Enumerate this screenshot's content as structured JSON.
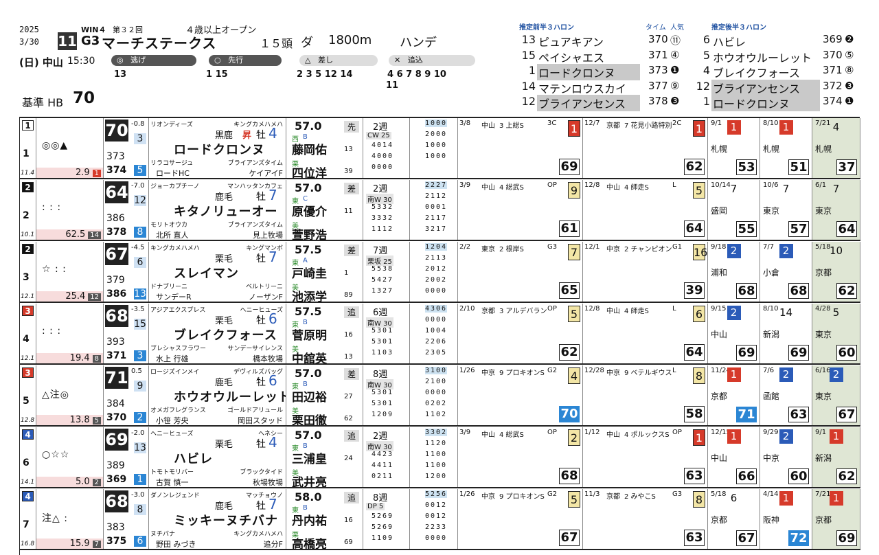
{
  "race": {
    "year": "2025",
    "date": "3/30",
    "day_venue": "(日) 中山",
    "time": "15:30",
    "race_no": "11",
    "win_label": "WIN４",
    "edition": "第３２回",
    "grade": "G3",
    "name": "マーチステークス",
    "condition": "４歳以上オープン",
    "field": "１５頭",
    "surface": "ダ",
    "distance": "1800m",
    "weight_rule": "ハンデ",
    "std_label": "基準 HB",
    "std_value": "70"
  },
  "pace": {
    "nige_label": "逃げ",
    "nige": "13",
    "senko_label": "先行",
    "senko": "1 15",
    "sashi_label": "差し",
    "sashi": "2 3 5 12 14",
    "oikomi_label": "追込",
    "oikomi": "4 6 7 8 9 10",
    "oikomi2": "11"
  },
  "front3f": {
    "title": "推定前半３ハロン",
    "col_time": "タイム",
    "col_pop": "人気",
    "rows": [
      {
        "no": "13",
        "name": "ピュアキアン",
        "time": "370",
        "pop": "⑪"
      },
      {
        "no": "15",
        "name": "ペイシャエス",
        "time": "371",
        "pop": "④"
      },
      {
        "no": "1",
        "name": "ロードクロンヌ",
        "time": "373",
        "pop": "❶"
      },
      {
        "no": "14",
        "name": "マテンロウスカイ",
        "time": "377",
        "pop": "⑨"
      },
      {
        "no": "12",
        "name": "ブライアンセンス",
        "time": "378",
        "pop": "❸"
      }
    ]
  },
  "back3f": {
    "title": "推定後半３ハロン",
    "rows": [
      {
        "no": "6",
        "name": "ハビレ",
        "time": "369",
        "pop": "❷"
      },
      {
        "no": "5",
        "name": "ホウオウルーレット",
        "time": "370",
        "pop": "⑤"
      },
      {
        "no": "4",
        "name": "ブレイクフォース",
        "time": "371",
        "pop": "⑧"
      },
      {
        "no": "12",
        "name": "ブライアンセンス",
        "time": "372",
        "pop": "❸"
      },
      {
        "no": "1",
        "name": "ロードクロンヌ",
        "time": "374",
        "pop": "❶"
      }
    ]
  },
  "horses": [
    {
      "gate": "1",
      "gate_bg": "#ffffff",
      "gate_fg": "#111",
      "no": "1",
      "marks": "◎◎▲",
      "weight": "11.4",
      "odds": "2.9",
      "pop": "1",
      "idx": "70",
      "idx_diff": "-0.8",
      "i1": "373",
      "i2": "374",
      "ia": "3",
      "ib": "5",
      "sire": "リオンディーズ",
      "dam_sire_top": "キングカメハメハ",
      "color": "黒鹿",
      "tag": "昇",
      "sex": "牡",
      "age": "4",
      "name": "ロードクロンヌ",
      "dam": "リラコサージュ",
      "damsire": "ブライアンズタイム",
      "owner": "ロードHC",
      "breeder": "ケイアイF",
      "kg": "57.0",
      "style": "先",
      "st1": "西",
      "st2": "B",
      "j1": "藤岡佑",
      "j1n": "13",
      "trainer_mark": "栗",
      "j2": "四位洋",
      "j2n": "39",
      "wk": "2週",
      "train": "CW 25",
      "tr": [
        "4014",
        "4000",
        "0000"
      ],
      "dist": [
        "1000",
        "2000",
        "1000",
        "1000"
      ],
      "p1": {
        "date": "3/8",
        "venue": "中山",
        "cls": "3 上総S",
        "grade": "3C",
        "rank": "1",
        "fig": "69"
      },
      "p2": {
        "date": "12/7",
        "venue": "京都",
        "cls": "7 花見小路特別",
        "grade": "2C",
        "rank": "1",
        "fig": "62"
      },
      "s1": {
        "date": "9/1",
        "rank": "1",
        "place": "札幌",
        "fig": "53"
      },
      "s2": {
        "date": "8/10",
        "rank": "1",
        "place": "札幌",
        "fig": "51"
      },
      "s3": {
        "date": "7/21",
        "rank": "4",
        "place": "札幌",
        "fig": "37"
      }
    },
    {
      "gate": "2",
      "gate_bg": "#111111",
      "gate_fg": "#fff",
      "no": "2",
      "marks": ": : :",
      "weight": "10.1",
      "odds": "62.5",
      "pop": "14",
      "idx": "64",
      "idx_diff": "-7.0",
      "i1": "386",
      "i2": "378",
      "ia": "12",
      "ib": "8",
      "sire": "ジョーカプチーノ",
      "dam_sire_top": "マンハッタンカフェ",
      "color": "鹿毛",
      "tag": "",
      "sex": "牡",
      "age": "7",
      "name": "キタノリューオー",
      "dam": "モリトオウカ",
      "damsire": "ブライアンズタイム",
      "owner": "北所 直人",
      "breeder": "見上牧場",
      "kg": "57.0",
      "style": "差",
      "st1": "東",
      "st2": "C",
      "j1": "原優介",
      "j1n": "11",
      "trainer_mark": "美",
      "j2": "萱野浩",
      "j2n": "",
      "wk": "2週",
      "train": "南W 30",
      "tr": [
        "5332",
        "3332",
        "1112"
      ],
      "dist": [
        "2227",
        "2112",
        "0001",
        "2117",
        "3217"
      ],
      "p1": {
        "date": "3/9",
        "venue": "中山",
        "cls": "4 総武S",
        "grade": "OP",
        "rank": "9",
        "fig": "61"
      },
      "p2": {
        "date": "12/8",
        "venue": "中山",
        "cls": "4 師走S",
        "grade": "L",
        "rank": "5",
        "fig": "64"
      },
      "s1": {
        "date": "10/14",
        "rank": "7",
        "place": "盛岡",
        "fig": "55"
      },
      "s2": {
        "date": "10/6",
        "rank": "7",
        "place": "東京",
        "fig": "57"
      },
      "s3": {
        "date": "6/1",
        "rank": "7",
        "place": "東京",
        "fig": "64"
      }
    },
    {
      "gate": "2",
      "gate_bg": "#111111",
      "gate_fg": "#fff",
      "no": "3",
      "marks": "☆ : :",
      "weight": "12.1",
      "odds": "25.4",
      "pop": "12",
      "idx": "67",
      "idx_diff": "-4.5",
      "i1": "379",
      "i2": "386",
      "ia": "6",
      "ib": "13",
      "sire": "キングカメハメハ",
      "dam_sire_top": "キングマンボ",
      "color": "栗毛",
      "tag": "",
      "sex": "牡",
      "age": "7",
      "name": "スレイマン",
      "dam": "ドナブリーニ",
      "damsire": "ベルトリーニ",
      "owner": "サンデーR",
      "breeder": "ノーザンF",
      "kg": "57.5",
      "style": "差",
      "st1": "東",
      "st2": "A",
      "j1": "戸崎圭",
      "j1n": "1",
      "trainer_mark": "美",
      "j2": "池添学",
      "j2n": "89",
      "wk": "7週",
      "train": "栗坂 25",
      "tr": [
        "5538",
        "5427",
        "1327"
      ],
      "dist": [
        "1204",
        "2113",
        "2012",
        "2002",
        "0000"
      ],
      "p1": {
        "date": "2/2",
        "venue": "東京",
        "cls": "2 根岸S",
        "grade": "G3",
        "rank": "7",
        "fig": "65"
      },
      "p2": {
        "date": "12/1",
        "venue": "中京",
        "cls": "2 チャンピオン",
        "grade": "G1",
        "rank": "16",
        "fig": "39"
      },
      "s1": {
        "date": "9/18",
        "rank": "2",
        "place": "浦和",
        "fig": "68"
      },
      "s2": {
        "date": "7/7",
        "rank": "2",
        "place": "小倉",
        "fig": "68"
      },
      "s3": {
        "date": "5/18",
        "rank": "10",
        "place": "京都",
        "fig": "62"
      }
    },
    {
      "gate": "3",
      "gate_bg": "#d63a2a",
      "gate_fg": "#fff",
      "no": "4",
      "marks": ": : :",
      "weight": "12.1",
      "odds": "19.4",
      "pop": "8",
      "idx": "68",
      "idx_diff": "-3.5",
      "i1": "393",
      "i2": "371",
      "ia": "15",
      "ib": "3",
      "sire": "アジアエクスプレス",
      "dam_sire_top": "ヘニーヒューズ",
      "color": "栗毛",
      "tag": "",
      "sex": "牡",
      "age": "6",
      "name": "ブレイクフォース",
      "dam": "ブレシャスフラワー",
      "damsire": "サンデーサイレンス",
      "owner": "水上 行雄",
      "breeder": "橋本牧場",
      "kg": "57.5",
      "style": "追",
      "st1": "東",
      "st2": "B",
      "j1": "菅原明",
      "j1n": "16",
      "trainer_mark": "美",
      "j2": "中舘英",
      "j2n": "13",
      "wk": "6週",
      "train": "南W 30",
      "tr": [
        "5301",
        "5301",
        "1103"
      ],
      "dist": [
        "4306",
        "0000",
        "1004",
        "2206",
        "2305"
      ],
      "p1": {
        "date": "2/10",
        "venue": "京都",
        "cls": "3 アルデバラン",
        "grade": "OP",
        "rank": "5",
        "fig": "62"
      },
      "p2": {
        "date": "12/8",
        "venue": "中山",
        "cls": "4 師走S",
        "grade": "L",
        "rank": "6",
        "fig": "64"
      },
      "s1": {
        "date": "9/15",
        "rank": "2",
        "place": "中山",
        "fig": "69"
      },
      "s2": {
        "date": "8/10",
        "rank": "14",
        "place": "新潟",
        "fig": "69"
      },
      "s3": {
        "date": "4/28",
        "rank": "5",
        "place": "東京",
        "fig": "60"
      }
    },
    {
      "gate": "3",
      "gate_bg": "#d63a2a",
      "gate_fg": "#fff",
      "no": "5",
      "marks": "△注◎",
      "weight": "12.8",
      "odds": "13.8",
      "pop": "5",
      "idx": "71",
      "idx_diff": "0.5",
      "i1": "384",
      "i2": "370",
      "ia": "9",
      "ib": "2",
      "sire": "ロージズインメイ",
      "dam_sire_top": "デヴィルズバッグ",
      "color": "鹿毛",
      "tag": "",
      "sex": "牡",
      "age": "6",
      "name": "ホウオウルーレット",
      "dam": "オメガフレグランス",
      "damsire": "ゴールドアリュール",
      "owner": "小笹 芳央",
      "breeder": "岡田スタッド",
      "kg": "57.0",
      "style": "差",
      "st1": "東",
      "st2": "B",
      "j1": "田辺裕",
      "j1n": "27",
      "trainer_mark": "美",
      "j2": "栗田徹",
      "j2n": "62",
      "wk": "8週",
      "train": "南W 30",
      "tr": [
        "5301",
        "5301",
        "1209"
      ],
      "dist": [
        "3100",
        "2100",
        "0000",
        "0202",
        "1102"
      ],
      "p1": {
        "date": "1/26",
        "venue": "中京",
        "cls": "9 プロキオンS",
        "grade": "G2",
        "rank": "4",
        "fig": "70"
      },
      "p2": {
        "date": "12/28",
        "venue": "中京",
        "cls": "9 ベテルギウス",
        "grade": "L",
        "rank": "8",
        "fig": "58"
      },
      "s1": {
        "date": "11/24",
        "rank": "1",
        "place": "京都",
        "fig": "71"
      },
      "s2": {
        "date": "7/6",
        "rank": "2",
        "place": "函館",
        "fig": "63"
      },
      "s3": {
        "date": "6/16",
        "rank": "2",
        "place": "東京",
        "fig": "67"
      }
    },
    {
      "gate": "4",
      "gate_bg": "#2b5bb8",
      "gate_fg": "#fff",
      "no": "6",
      "marks": "○☆☆",
      "weight": "14.1",
      "odds": "5.0",
      "pop": "2",
      "idx": "69",
      "idx_diff": "-2.0",
      "i1": "389",
      "i2": "369",
      "ia": "13",
      "ib": "1",
      "sire": "ヘニーヒューズ",
      "dam_sire_top": "ヘネシー",
      "color": "栗毛",
      "tag": "",
      "sex": "牡",
      "age": "4",
      "name": "ハビレ",
      "dam": "トモトモリバー",
      "damsire": "ブラックタイド",
      "owner": "古賀 慎一",
      "breeder": "秋場牧場",
      "kg": "57.0",
      "style": "追",
      "st1": "東",
      "st2": "B",
      "j1": "三浦皇",
      "j1n": "24",
      "trainer_mark": "美",
      "j2": "武井亮",
      "j2n": "",
      "wk": "2週",
      "train": "南W 30",
      "tr": [
        "4423",
        "4411",
        "0211"
      ],
      "dist": [
        "3302",
        "1120",
        "1100",
        "1100",
        "1200"
      ],
      "p1": {
        "date": "3/9",
        "venue": "中山",
        "cls": "4 総武S",
        "grade": "OP",
        "rank": "2",
        "fig": "68"
      },
      "p2": {
        "date": "1/12",
        "venue": "中山",
        "cls": "4 ポルックスS",
        "grade": "OP",
        "rank": "1",
        "fig": "63"
      },
      "s1": {
        "date": "12/15",
        "rank": "1",
        "place": "中山",
        "fig": "66"
      },
      "s2": {
        "date": "9/29",
        "rank": "2",
        "place": "中京",
        "fig": "60"
      },
      "s3": {
        "date": "9/1",
        "rank": "1",
        "place": "新潟",
        "fig": "62"
      }
    },
    {
      "gate": "4",
      "gate_bg": "#2b5bb8",
      "gate_fg": "#fff",
      "no": "7",
      "marks": "注△ :",
      "weight": "16.8",
      "odds": "15.9",
      "pop": "7",
      "idx": "68",
      "idx_diff": "-3.0",
      "i1": "383",
      "i2": "375",
      "ia": "8",
      "ib": "6",
      "sire": "ダノンレジェンド",
      "dam_sire_top": "マッチョウノ",
      "color": "鹿毛",
      "tag": "",
      "sex": "牡",
      "age": "7",
      "name": "ミッキーヌチバナ",
      "dam": "ヌチバナ",
      "damsire": "キングカメハメハ",
      "owner": "野田 みづき",
      "breeder": "追分F",
      "kg": "58.0",
      "style": "追",
      "st1": "東",
      "st2": "B",
      "j1": "丹内祐",
      "j1n": "16",
      "trainer_mark": "栗",
      "j2": "高橋亮",
      "j2n": "69",
      "wk": "8週",
      "train": "DP 5",
      "tr": [
        "5269",
        "5269",
        "1109"
      ],
      "dist": [
        "5256",
        "0012",
        "0012",
        "2233",
        "0000"
      ],
      "p1": {
        "date": "1/26",
        "venue": "中京",
        "cls": "9 プロキオンS",
        "grade": "G2",
        "rank": "5",
        "fig": "67"
      },
      "p2": {
        "date": "11/3",
        "venue": "京都",
        "cls": "2 みやこS",
        "grade": "G3",
        "rank": "8",
        "fig": "63"
      },
      "s1": {
        "date": "5/18",
        "rank": "6",
        "place": "京都",
        "fig": "67"
      },
      "s2": {
        "date": "4/14",
        "rank": "1",
        "place": "阪神",
        "fig": "72"
      },
      "s3": {
        "date": "7/21",
        "rank": "1",
        "place": "京都",
        "fig": "69"
      }
    }
  ],
  "colors": {
    "index_bg": "#222222",
    "gate_white": "#ffffff",
    "highlight_blue": "#2b86d4",
    "win_red": "#d63a2a"
  }
}
